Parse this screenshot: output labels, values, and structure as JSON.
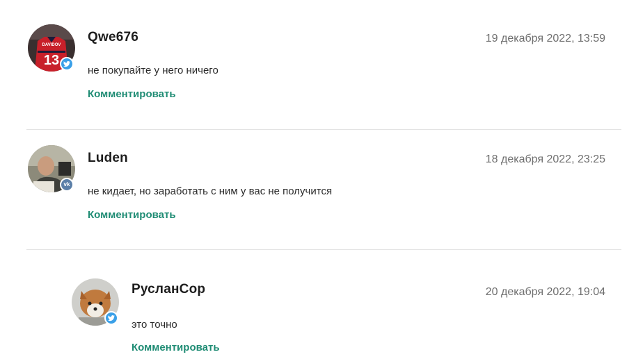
{
  "comments": [
    {
      "author": "Qwe676",
      "date": "19 декабря 2022, 13:59",
      "text": "не покупайте у него ничего",
      "reply_label": "Комментировать",
      "social": "twitter-icon",
      "jersey_number": "13",
      "jersey_name": "DAVIDOV"
    },
    {
      "author": "Luden",
      "date": "18 декабря 2022, 23:25",
      "text": "не кидает, но заработать с ним у вас не получится",
      "reply_label": "Комментировать",
      "social": "vk-icon"
    },
    {
      "author": "РусланСор",
      "date": "20 декабря 2022, 19:04",
      "text": "это точно",
      "reply_label": "Комментировать",
      "social": "twitter-icon"
    }
  ],
  "colors": {
    "link": "#1f8c74",
    "date": "#6f6f6f",
    "divider": "#e3e3e3",
    "twitter": "#3aa0e8",
    "vk": "#5b7fa8"
  }
}
